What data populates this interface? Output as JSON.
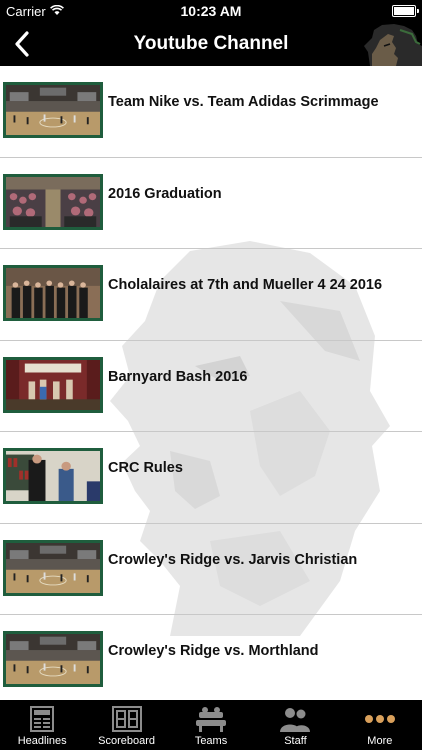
{
  "status": {
    "carrier": "Carrier",
    "time": "10:23 AM"
  },
  "nav": {
    "title": "Youtube Channel"
  },
  "videos": [
    {
      "title": "Team Nike vs. Team Adidas Scrimmage",
      "thumb": "gym"
    },
    {
      "title": "2016 Graduation",
      "thumb": "crowd"
    },
    {
      "title": "Cholalaires at 7th and Mueller 4 24 2016",
      "thumb": "choir"
    },
    {
      "title": "Barnyard Bash 2016",
      "thumb": "stage"
    },
    {
      "title": "CRC Rules",
      "thumb": "library"
    },
    {
      "title": "Crowley's Ridge vs. Jarvis Christian",
      "thumb": "gym"
    },
    {
      "title": "Crowley's Ridge vs. Morthland",
      "thumb": "gym"
    }
  ],
  "tabs": [
    {
      "label": "Headlines",
      "icon": "newspaper-icon",
      "active": false
    },
    {
      "label": "Scoreboard",
      "icon": "scoreboard-icon",
      "active": false
    },
    {
      "label": "Teams",
      "icon": "bench-icon",
      "active": false
    },
    {
      "label": "Staff",
      "icon": "people-icon",
      "active": false
    },
    {
      "label": "More",
      "icon": "more-dots-icon",
      "active": true
    }
  ],
  "colors": {
    "thumb_border": "#1f5d3d",
    "active_tab": "#d9a05b",
    "inactive_tab": "#8c8c8c",
    "bars": "#000000"
  }
}
